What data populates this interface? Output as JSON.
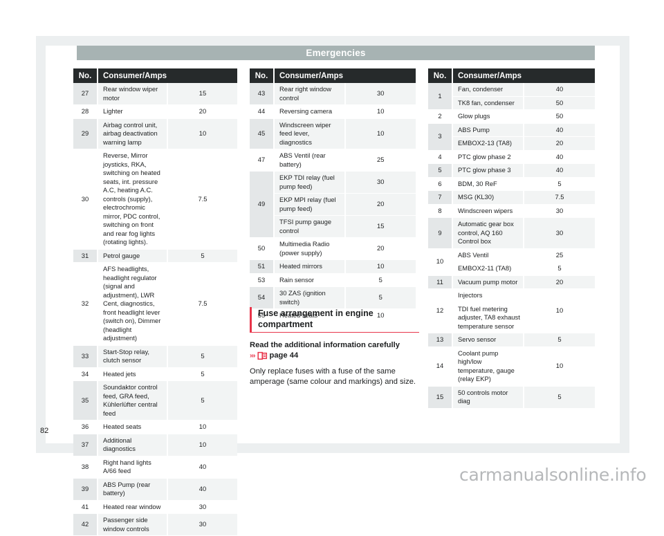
{
  "header": {
    "chapter_title": "Emergencies"
  },
  "footer": {
    "page_number": "82",
    "watermark": "carmanualsonline.info"
  },
  "table_headers": {
    "no": "No.",
    "consumer": "Consumer/Amps"
  },
  "tables": [
    {
      "id": "fuse-table-left",
      "rows": [
        {
          "no": "27",
          "items": [
            {
              "name": "Rear window wiper motor",
              "amps": "15"
            }
          ]
        },
        {
          "no": "28",
          "items": [
            {
              "name": "Lighter",
              "amps": "20"
            }
          ]
        },
        {
          "no": "29",
          "items": [
            {
              "name": "Airbag control unit, airbag deactivation warning lamp",
              "amps": "10"
            }
          ]
        },
        {
          "no": "30",
          "items": [
            {
              "name": "Reverse, Mirror joysticks, RKA, switching on heated seats, int. pressure A.C, heating A.C. controls (supply), electrochromic mirror, PDC control, switching on front and rear fog lights (rotating lights).",
              "amps": "7.5"
            }
          ]
        },
        {
          "no": "31",
          "items": [
            {
              "name": "Petrol gauge",
              "amps": "5"
            }
          ]
        },
        {
          "no": "32",
          "items": [
            {
              "name": "AFS headlights, headlight regulator (signal and adjustment), LWR Cent, diagnostics, front headlight lever (switch on), Dimmer (headlight adjustment)",
              "amps": "7.5"
            }
          ]
        },
        {
          "no": "33",
          "items": [
            {
              "name": "Start-Stop relay, clutch sensor",
              "amps": "5"
            }
          ]
        },
        {
          "no": "34",
          "items": [
            {
              "name": "Heated jets",
              "amps": "5"
            }
          ]
        },
        {
          "no": "35",
          "items": [
            {
              "name": "Soundaktor control feed, GRA feed, Kühlerlüfter central feed",
              "amps": "5"
            }
          ]
        },
        {
          "no": "36",
          "items": [
            {
              "name": "Heated seats",
              "amps": "10"
            }
          ]
        },
        {
          "no": "37",
          "items": [
            {
              "name": "Additional diagnostics",
              "amps": "10"
            }
          ]
        },
        {
          "no": "38",
          "items": [
            {
              "name": "Right hand lights A/66 feed",
              "amps": "40"
            }
          ]
        },
        {
          "no": "39",
          "items": [
            {
              "name": "ABS Pump (rear battery)",
              "amps": "40"
            }
          ]
        },
        {
          "no": "41",
          "items": [
            {
              "name": "Heated rear window",
              "amps": "30"
            }
          ]
        },
        {
          "no": "42",
          "items": [
            {
              "name": "Passenger side window controls",
              "amps": "30"
            }
          ]
        }
      ]
    },
    {
      "id": "fuse-table-middle",
      "rows": [
        {
          "no": "43",
          "items": [
            {
              "name": "Rear right window control",
              "amps": "30"
            }
          ]
        },
        {
          "no": "44",
          "items": [
            {
              "name": "Reversing camera",
              "amps": "10"
            }
          ]
        },
        {
          "no": "45",
          "items": [
            {
              "name": "Windscreen wiper feed lever, diagnostics",
              "amps": "10"
            }
          ]
        },
        {
          "no": "47",
          "items": [
            {
              "name": "ABS Ventil (rear battery)",
              "amps": "25"
            }
          ]
        },
        {
          "no": "49",
          "items": [
            {
              "name": "EKP TDI relay (fuel pump feed)",
              "amps": "30"
            },
            {
              "name": "EKP MPI relay (fuel pump feed)",
              "amps": "20"
            },
            {
              "name": "TFSI pump gauge control",
              "amps": "15"
            }
          ]
        },
        {
          "no": "50",
          "items": [
            {
              "name": "Multimedia Radio (power supply)",
              "amps": "20"
            }
          ]
        },
        {
          "no": "51",
          "items": [
            {
              "name": "Heated mirrors",
              "amps": "10"
            }
          ]
        },
        {
          "no": "53",
          "items": [
            {
              "name": "Rain sensor",
              "amps": "5"
            }
          ]
        },
        {
          "no": "54",
          "items": [
            {
              "name": "30 ZAS (ignition switch)",
              "amps": "5"
            }
          ]
        },
        {
          "no": "55",
          "items": [
            {
              "name": "Heated seats",
              "amps": "10"
            }
          ]
        }
      ]
    },
    {
      "id": "fuse-table-right",
      "rows": [
        {
          "no": "1",
          "items": [
            {
              "name": "Fan, condenser",
              "amps": "40"
            },
            {
              "name": "TK8 fan, condenser",
              "amps": "50"
            }
          ]
        },
        {
          "no": "2",
          "items": [
            {
              "name": "Glow plugs",
              "amps": "50"
            }
          ]
        },
        {
          "no": "3",
          "items": [
            {
              "name": "ABS Pump",
              "amps": "40"
            },
            {
              "name": "EMBOX2-13 (TA8)",
              "amps": "20"
            }
          ]
        },
        {
          "no": "4",
          "items": [
            {
              "name": "PTC glow phase 2",
              "amps": "40"
            }
          ]
        },
        {
          "no": "5",
          "items": [
            {
              "name": "PTC glow phase 3",
              "amps": "40"
            }
          ]
        },
        {
          "no": "6",
          "items": [
            {
              "name": "BDM, 30 ReF",
              "amps": "5"
            }
          ]
        },
        {
          "no": "7",
          "items": [
            {
              "name": "MSG (KL30)",
              "amps": "7.5"
            }
          ]
        },
        {
          "no": "8",
          "items": [
            {
              "name": "Windscreen wipers",
              "amps": "30"
            }
          ]
        },
        {
          "no": "9",
          "items": [
            {
              "name": "Automatic gear box control, AQ 160 Control box",
              "amps": "30"
            }
          ]
        },
        {
          "no": "10",
          "items": [
            {
              "name": "ABS Ventil",
              "amps": "25"
            },
            {
              "name": "EMBOX2-11 (TA8)",
              "amps": "5"
            }
          ]
        },
        {
          "no": "11",
          "items": [
            {
              "name": "Vacuum pump motor",
              "amps": "20"
            }
          ]
        },
        {
          "no": "12",
          "span_amp": "10",
          "items": [
            {
              "name": "Injectors"
            },
            {
              "name": "TDI fuel metering adjuster, TA8 exhaust temperature sensor"
            }
          ]
        },
        {
          "no": "13",
          "items": [
            {
              "name": "Servo sensor",
              "amps": "5"
            }
          ]
        },
        {
          "no": "14",
          "items": [
            {
              "name": "Coolant pump high/low temperature, gauge (relay EKP)",
              "amps": "10"
            }
          ]
        },
        {
          "no": "15",
          "items": [
            {
              "name": "50 controls motor diag",
              "amps": "5"
            }
          ]
        }
      ]
    }
  ],
  "arrangement": {
    "title": "Fuse arrangement in engine compartment",
    "lead": "Read the additional information carefully",
    "chevrons": "›››",
    "page_ref": "page 44",
    "body": "Only replace fuses with a fuse of the same amperage (same colour and markings) and size."
  },
  "colors": {
    "accent_red": "#e8344a",
    "banner_gray": "#a7b3b3",
    "header_dark": "#262a2b"
  }
}
